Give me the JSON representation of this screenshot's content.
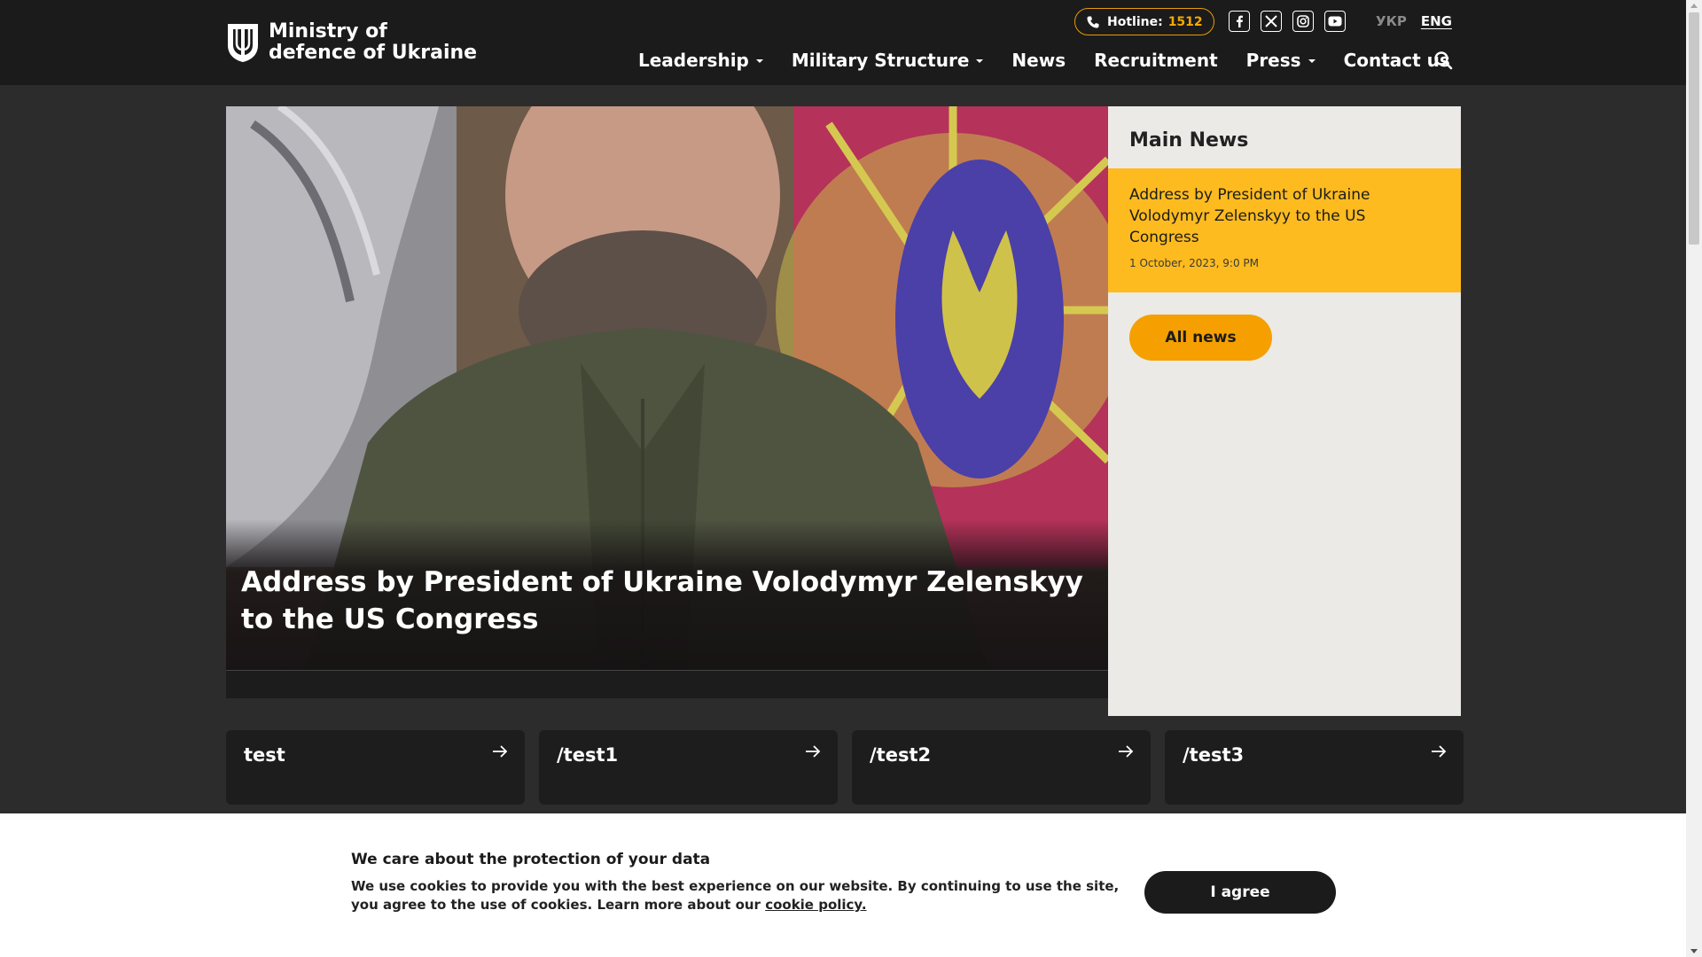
{
  "header": {
    "logo_line1": "Ministry of",
    "logo_line2": "defence of Ukraine",
    "hotline_label": "Hotline:",
    "hotline_number": "1512",
    "languages": {
      "ukr": "УКР",
      "eng": "ENG"
    },
    "nav": {
      "leadership": "Leadership",
      "military_structure": "Military Structure",
      "news": "News",
      "recruitment": "Recruitment",
      "press": "Press",
      "contact": "Contact us"
    }
  },
  "hero": {
    "title": "Address by President of Ukraine Volodymyr Zelenskyy to the US Congress"
  },
  "main_news": {
    "heading": "Main News",
    "item_title": "Address by President of Ukraine Volodymyr Zelenskyy to the US Congress",
    "item_date": "1 October, 2023, 9:0 PM",
    "all_news_label": "All news"
  },
  "cards": [
    "test",
    "/test1",
    "/test2",
    "/test3"
  ],
  "cookie": {
    "title": "We care about the protection of your data",
    "text": "We use cookies to provide you with the best experience on our website. By continuing to use the site, you agree to the use of cookies. Learn more about our",
    "link": "cookie policy.",
    "button": "I agree"
  },
  "colors": {
    "accent_yellow": "#fdbb1f",
    "accent_orange": "#f5a000",
    "header_bg": "#1b1b1b",
    "page_bg": "#2c2c2c"
  }
}
